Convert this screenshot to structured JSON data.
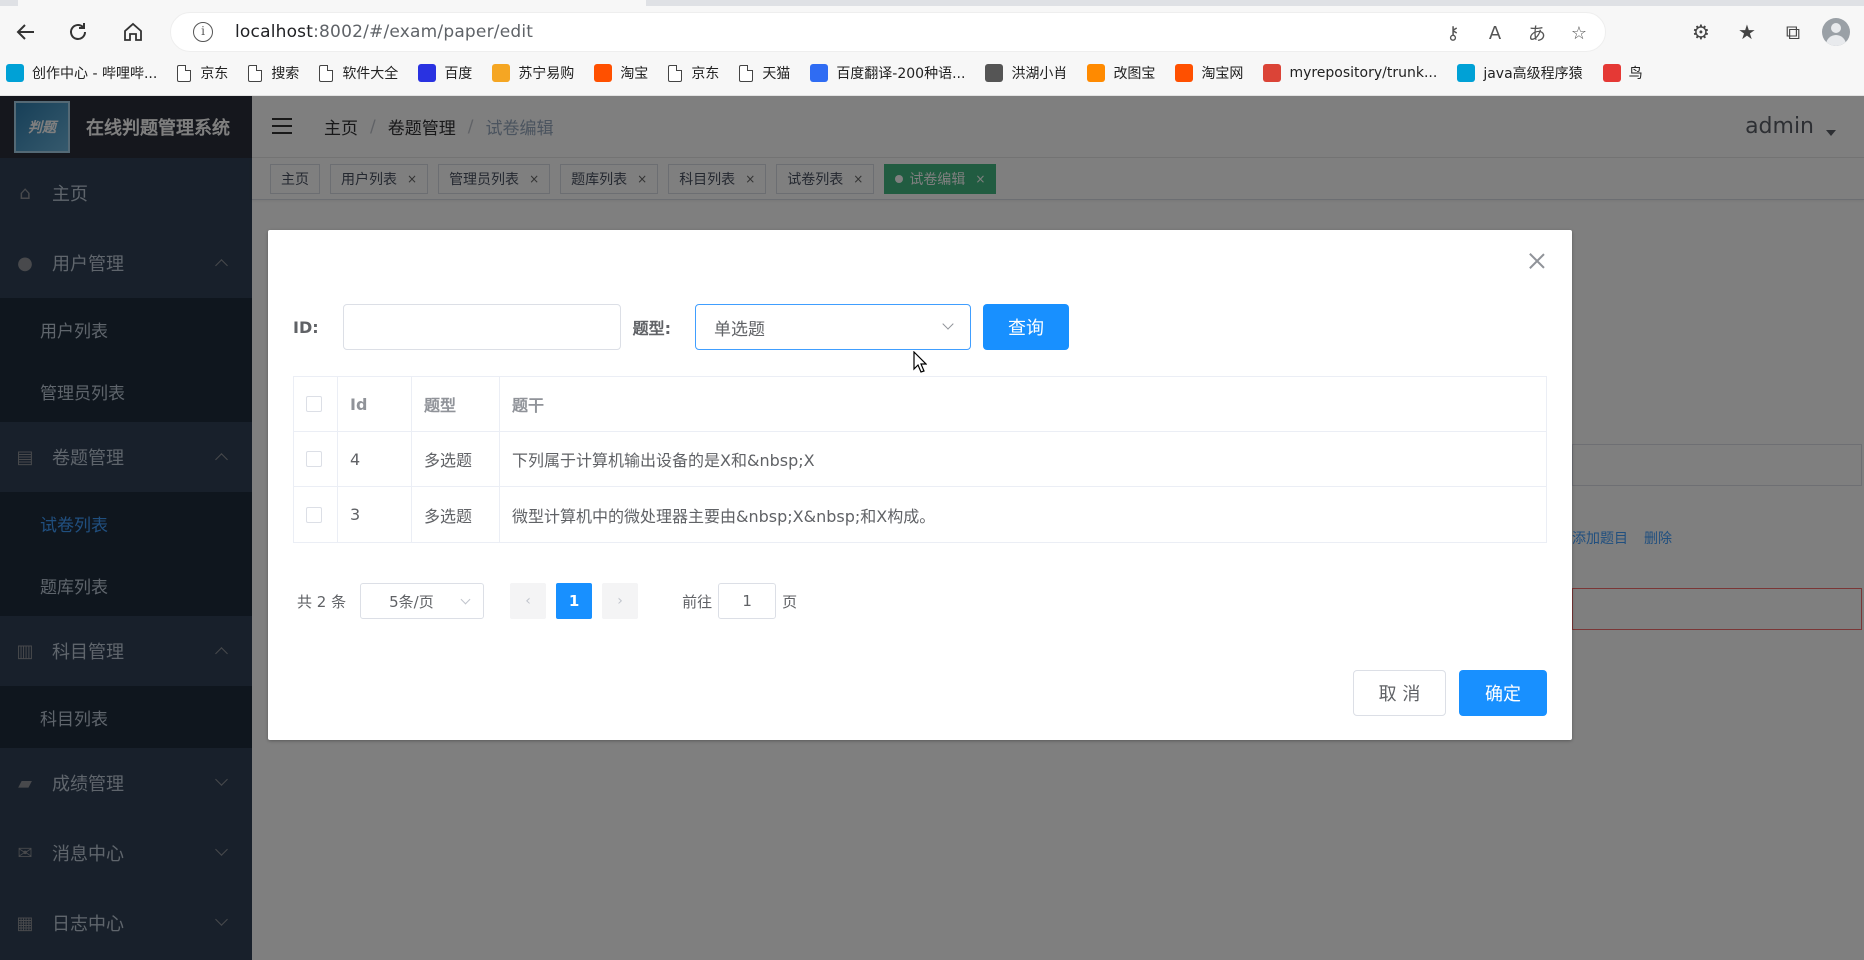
{
  "browser": {
    "url_host": "localhost",
    "url_path": ":8002/#/exam/paper/edit",
    "bookmarks": [
      {
        "label": "创作中心 - 哔哩哔...",
        "icon": "bilibili-icon",
        "color": "#00a1d6"
      },
      {
        "label": "京东",
        "icon": "page-icon"
      },
      {
        "label": "搜索",
        "icon": "page-icon"
      },
      {
        "label": "软件大全",
        "icon": "page-icon"
      },
      {
        "label": "百度",
        "icon": "baidu-icon",
        "color": "#2932e1"
      },
      {
        "label": "苏宁易购",
        "icon": "suning-icon",
        "color": "#f5a623"
      },
      {
        "label": "淘宝",
        "icon": "taobao-icon",
        "color": "#ff5000"
      },
      {
        "label": "京东",
        "icon": "page-icon"
      },
      {
        "label": "天猫",
        "icon": "page-icon"
      },
      {
        "label": "百度翻译-200种语...",
        "icon": "translate-icon",
        "color": "#2f6cf3"
      },
      {
        "label": "洪湖小肖",
        "icon": "bird-icon",
        "color": "#555555"
      },
      {
        "label": "改图宝",
        "icon": "gaitubao-icon",
        "color": "#ff8a00"
      },
      {
        "label": "淘宝网",
        "icon": "taobao-icon",
        "color": "#ff5000"
      },
      {
        "label": "myrepository/trunk...",
        "icon": "chrome-icon",
        "color": "#db4437"
      },
      {
        "label": "java高级程序猿",
        "icon": "bilibili-icon",
        "color": "#00a1d6"
      },
      {
        "label": "鸟",
        "icon": "bird-red-icon",
        "color": "#e53935"
      }
    ]
  },
  "app": {
    "logo_text": "在线判题管理系统",
    "logo_mark": "判题",
    "sidebar": {
      "home": "主页",
      "user_mgmt": "用户管理",
      "user_list": "用户列表",
      "admin_list": "管理员列表",
      "paper_mgmt": "卷题管理",
      "paper_list": "试卷列表",
      "question_list": "题库列表",
      "subject_mgmt": "科目管理",
      "subject_list": "科目列表",
      "score_mgmt": "成绩管理",
      "message_center": "消息中心",
      "log_center": "日志中心"
    },
    "breadcrumb": [
      "主页",
      "卷题管理",
      "试卷编辑"
    ],
    "user": "admin",
    "tags": [
      "主页",
      "用户列表",
      "管理员列表",
      "题库列表",
      "科目列表",
      "试卷列表",
      "试卷编辑"
    ],
    "bg_links": [
      "添加题目",
      "删除"
    ]
  },
  "dialog": {
    "id_label": "ID:",
    "id_value": "",
    "type_label": "题型:",
    "type_value": "单选题",
    "query_button": "查询",
    "columns": [
      "Id",
      "题型",
      "题干"
    ],
    "rows": [
      {
        "id": "4",
        "type": "多选题",
        "stem": "下列属于计算机输出设备的是X和&nbsp;X"
      },
      {
        "id": "3",
        "type": "多选题",
        "stem": "微型计算机中的微处理器主要由&nbsp;X&nbsp;和X构成。"
      }
    ],
    "pager": {
      "total": "共 2 条",
      "page_size": "5条/页",
      "current_page": "1",
      "goto_label": "前往",
      "goto_value": "1",
      "page_unit": "页"
    },
    "cancel_button": "取 消",
    "ok_button": "确定"
  },
  "colors": {
    "primary": "#1890ff",
    "sidebar_bg": "#304156",
    "active_tag": "#42b983",
    "active_menu": "#409eff"
  }
}
